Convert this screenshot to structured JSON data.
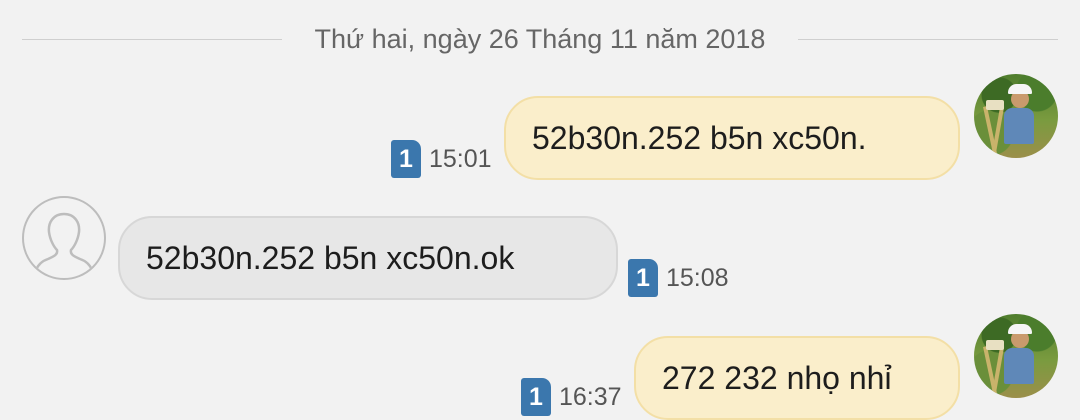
{
  "conversation": {
    "date_label": "Thứ hai, ngày 26 Tháng 11 năm 2018",
    "messages": [
      {
        "direction": "outgoing",
        "text": "52b30n.252 b5n xc50n.",
        "sim": "1",
        "time": "15:01"
      },
      {
        "direction": "incoming",
        "text": "52b30n.252 b5n xc50n.ok",
        "sim": "1",
        "time": "15:08"
      },
      {
        "direction": "outgoing",
        "text": "272 232 nhọ nhỉ",
        "sim": "1",
        "time": "16:37"
      }
    ]
  },
  "icons": {
    "sim": "sim-card-icon",
    "user_avatar": "user-avatar-photo",
    "contact_avatar": "default-contact-avatar-icon"
  },
  "colors": {
    "background": "#f2f2f2",
    "outgoing_bubble": "#faeecb",
    "incoming_bubble": "#e7e7e7",
    "sim_badge": "#3b77ad"
  }
}
